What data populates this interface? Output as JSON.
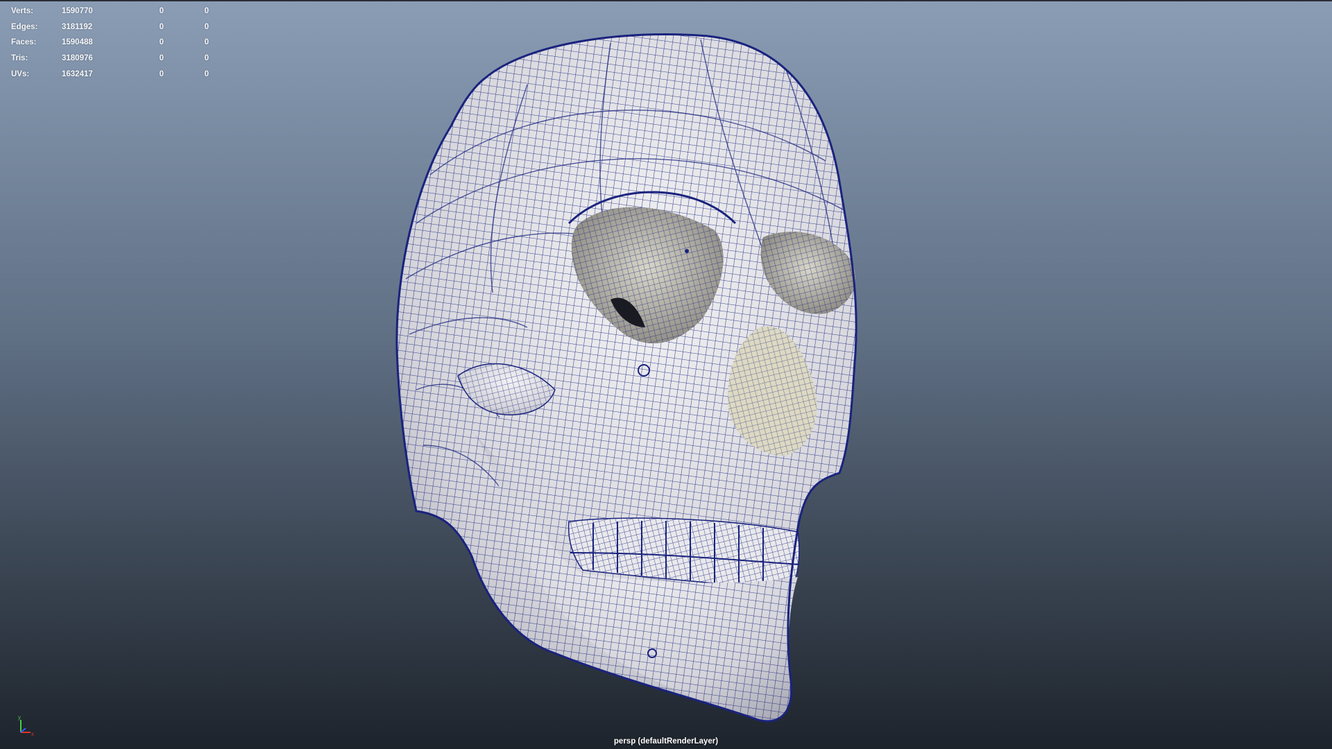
{
  "viewport": {
    "camera_label": "persp (defaultRenderLayer)",
    "background_top": "#8a9db5",
    "background_bottom": "#1d232b",
    "wire_color": "#1a237e",
    "mesh_color": "#e2e2e6"
  },
  "hud": {
    "rows": [
      {
        "label": "Verts:",
        "c0": "1590770",
        "c1": "0",
        "c2": "0"
      },
      {
        "label": "Edges:",
        "c0": "3181192",
        "c1": "0",
        "c2": "0"
      },
      {
        "label": "Faces:",
        "c0": "1590488",
        "c1": "0",
        "c2": "0"
      },
      {
        "label": "Tris:",
        "c0": "3180976",
        "c1": "0",
        "c2": "0"
      },
      {
        "label": "UVs:",
        "c0": "1632417",
        "c1": "0",
        "c2": "0"
      }
    ]
  },
  "axis": {
    "y_label": "y",
    "x_label": "x",
    "y_color": "#3fd13f",
    "x_color": "#e0302a",
    "z_color": "#3a5bff"
  }
}
